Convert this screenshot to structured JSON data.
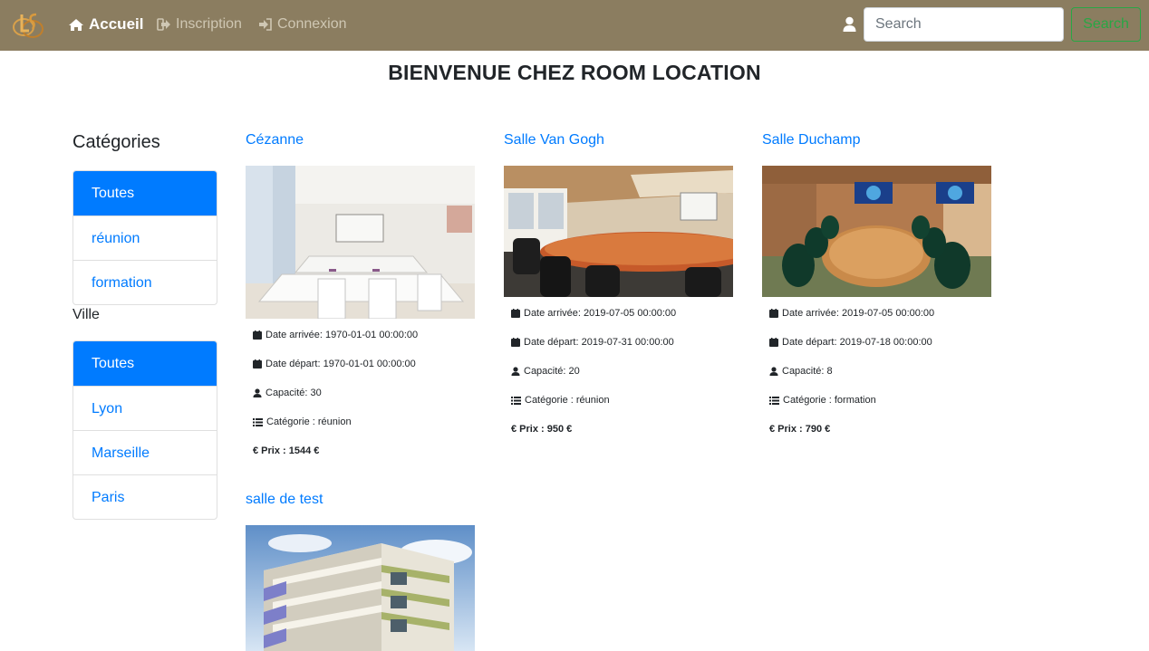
{
  "nav": {
    "home": "Accueil",
    "signup": "Inscription",
    "login": "Connexion",
    "search_placeholder": "Search",
    "search_button": "Search"
  },
  "page_title": "BIENVENUE CHEZ ROOM LOCATION",
  "sidebar": {
    "categories_title": "Catégories",
    "categories": [
      "Toutes",
      "réunion",
      "formation"
    ],
    "ville_title": "Ville",
    "villes": [
      "Toutes",
      "Lyon",
      "Marseille",
      "Paris"
    ]
  },
  "rooms": [
    {
      "title": "Cézanne",
      "arrival": "Date arrivée: 1970-01-01 00:00:00",
      "departure": "Date départ: 1970-01-01 00:00:00",
      "capacity": "Capacité: 30",
      "category": "Catégorie : réunion",
      "price": "€ Prix : 1544 €"
    },
    {
      "title": "Salle Van Gogh",
      "arrival": "Date arrivée: 2019-07-05 00:00:00",
      "departure": "Date départ: 2019-07-31 00:00:00",
      "capacity": "Capacité: 20",
      "category": "Catégorie : réunion",
      "price": "€ Prix : 950 €"
    },
    {
      "title": "Salle Duchamp",
      "arrival": "Date arrivée: 2019-07-05 00:00:00",
      "departure": "Date départ: 2019-07-18 00:00:00",
      "capacity": "Capacité: 8",
      "category": "Catégorie : formation",
      "price": "€ Prix : 790 €"
    },
    {
      "title": "salle de test"
    }
  ],
  "colors": {
    "navbar": "#8b7d60",
    "link": "#007bff",
    "search_button": "#28a745"
  },
  "icons": [
    "logo",
    "home-icon",
    "signup-icon",
    "login-icon",
    "user-icon",
    "calendar-icon",
    "person-icon",
    "list-icon"
  ]
}
